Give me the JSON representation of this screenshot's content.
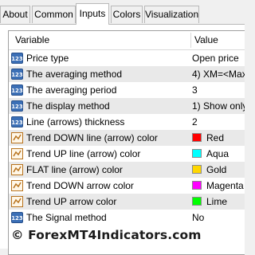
{
  "tabs": [
    {
      "label": "About"
    },
    {
      "label": "Common"
    },
    {
      "label": "Inputs"
    },
    {
      "label": "Colors"
    },
    {
      "label": "Visualization"
    }
  ],
  "active_tab": "Inputs",
  "table": {
    "headers": {
      "variable": "Variable",
      "value": "Value"
    },
    "rows": [
      {
        "icon": "numeric-123-icon",
        "name": "Price type",
        "value": "Open price"
      },
      {
        "icon": "numeric-123-icon",
        "name": "The averaging method",
        "value": "4) XM=<Max((Hi"
      },
      {
        "icon": "numeric-123-icon",
        "name": "The averaging period",
        "value": "3"
      },
      {
        "icon": "numeric-123-icon",
        "name": "The display method",
        "value": "1) Show only arr"
      },
      {
        "icon": "numeric-123-icon",
        "name": "Line (arrows) thickness",
        "value": "2"
      },
      {
        "icon": "color-line-icon",
        "name": "Trend DOWN line (arrow) color",
        "value": "Red",
        "color": "#ff0000"
      },
      {
        "icon": "color-line-icon",
        "name": "Trend UP line (arrow) color",
        "value": "Aqua",
        "color": "#00ffff"
      },
      {
        "icon": "color-line-icon",
        "name": "FLAT line (arrow) color",
        "value": "Gold",
        "color": "#ffd700"
      },
      {
        "icon": "color-line-icon",
        "name": "Trend DOWN arrow color",
        "value": "Magenta",
        "color": "#ff00ff"
      },
      {
        "icon": "color-line-icon",
        "name": "Trend UP arrow color",
        "value": "Lime",
        "color": "#00ff00"
      },
      {
        "icon": "numeric-123-icon",
        "name": "The Signal method",
        "value": "No"
      }
    ]
  },
  "watermark": "© ForexMT4Indicators.com",
  "colors": {
    "numeric_icon_fill": "#3b6fb6",
    "color_icon_stroke": "#b8731e",
    "alt_row": "#e9e9e9"
  }
}
